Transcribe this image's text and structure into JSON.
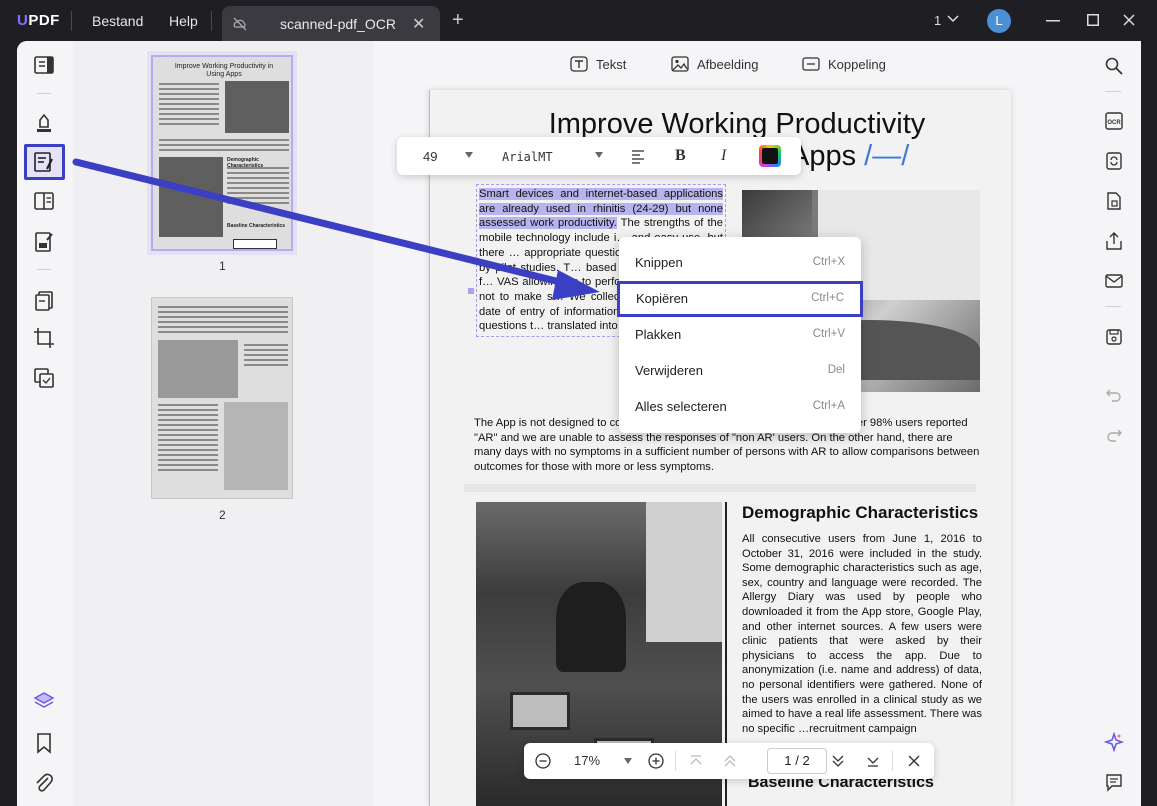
{
  "app": {
    "logo_u": "U",
    "logo_rest": "PDF",
    "menus": [
      "Bestand",
      "Help"
    ],
    "tab_title": "scanned-pdf_OCR",
    "window_count": "1",
    "avatar_letter": "L"
  },
  "icons": {
    "left": [
      "reader-icon",
      "comment-icon",
      "edit-pdf-icon",
      "page-layout-icon",
      "form-icon",
      "organize-pages-icon",
      "crop-icon",
      "convert-icon",
      "layers-icon",
      "bookmark-icon",
      "attachment-icon"
    ],
    "right": [
      "search-icon",
      "ocr-icon",
      "convert-icon",
      "protect-icon",
      "share-icon",
      "email-icon",
      "save-icon",
      "undo-icon",
      "redo-icon",
      "ai-assistant-icon",
      "comments-panel-icon"
    ]
  },
  "thumbnails": [
    {
      "page": "1",
      "title": "Improve Working Productivity in Using Apps"
    },
    {
      "page": "2"
    }
  ],
  "page_toolbar": {
    "text": "Tekst",
    "image": "Afbeelding",
    "link": "Koppeling"
  },
  "text_toolbar": {
    "font_size": "49",
    "font_name": "ArialMT",
    "bold": "B",
    "italic": "I"
  },
  "document": {
    "title_line1": "Improve Working Productivity",
    "title_line2": "Apps",
    "title_accent": "/—/",
    "selected_text": "Smart devices and internet-based applications are already used in rhinitis (24-29) but none assessed work productivity.",
    "para1_rest": " The strengths of the mobile technology include i… and easy use, but there … appropriate questions and … assessed by pilot studies. T… based on 1,136 users who f… VAS allowing us to perform … outcomes, but not to make s… We collected country, langu… date of entry of information… used very simple questions t… translated into 15 languages.",
    "para2": "The App is not designed to co… was not a clinical trial. Thus, as expected, over 98% users reported \"AR\" and we are unable to assess the responses of \"non AR' users. On the other hand, there are many days with no symptoms in a sufficient number of persons with AR to allow comparisons between outcomes for those with more or less symptoms.",
    "demo_heading": "Demographic Characteristics",
    "demo_para": "All consecutive users from June 1, 2016 to October 31, 2016 were included in the study. Some demographic characteristics such as age, sex, country and language were recorded. The Allergy Diary was used by people who downloaded it from the App store, Google Play, and other internet sources. A few users were clinic patients that were asked by their physicians to access the app. Due to anonymization (i.e. name and address) of data, no personal identifiers were gathered. None of the users was enrolled in a clinical study as we aimed to have a real life assessment. There was no specific …recruitment campaign",
    "baseline_heading": "Baseline Characteristics"
  },
  "context_menu": [
    {
      "label": "Knippen",
      "shortcut": "Ctrl+X"
    },
    {
      "label": "Kopiëren",
      "shortcut": "Ctrl+C",
      "highlighted": true
    },
    {
      "label": "Plakken",
      "shortcut": "Ctrl+V"
    },
    {
      "label": "Verwijderen",
      "shortcut": "Del"
    },
    {
      "label": "Alles selecteren",
      "shortcut": "Ctrl+A"
    }
  ],
  "zoom_bar": {
    "zoom": "17%",
    "page_current": "1",
    "page_sep": "/",
    "page_total": "2"
  },
  "colors": {
    "accent": "#3b3fc4",
    "selection": "#b7b3ee",
    "brand": "#8b6cf6"
  }
}
